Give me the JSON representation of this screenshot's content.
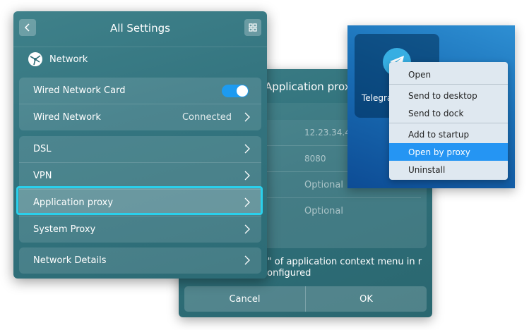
{
  "proxy_dialog": {
    "title": "Application proxy",
    "rows": [
      {
        "value": "12.23.34.45"
      },
      {
        "value": "8080"
      },
      {
        "value": "Optional"
      },
      {
        "value": "Optional"
      }
    ],
    "note": "y\" of application context menu in r configured",
    "cancel_label": "Cancel",
    "ok_label": "OK"
  },
  "settings": {
    "title": "All Settings",
    "section_title": "Network",
    "wired_card_label": "Wired Network Card",
    "wired_card_enabled": true,
    "wired_network_label": "Wired Network",
    "wired_network_status": "Connected",
    "dsl_label": "DSL",
    "vpn_label": "VPN",
    "app_proxy_label": "Application proxy",
    "system_proxy_label": "System Proxy",
    "network_details_label": "Network Details"
  },
  "desktop": {
    "app_label": "Telegra",
    "menu": {
      "open": "Open",
      "send_desktop": "Send to desktop",
      "send_dock": "Send to dock",
      "add_startup": "Add to startup",
      "open_proxy": "Open by proxy",
      "uninstall": "Uninstall"
    }
  },
  "colors": {
    "accent": "#1d9bf0",
    "highlight": "#2ad0ec",
    "menu_active": "#2595f3"
  }
}
